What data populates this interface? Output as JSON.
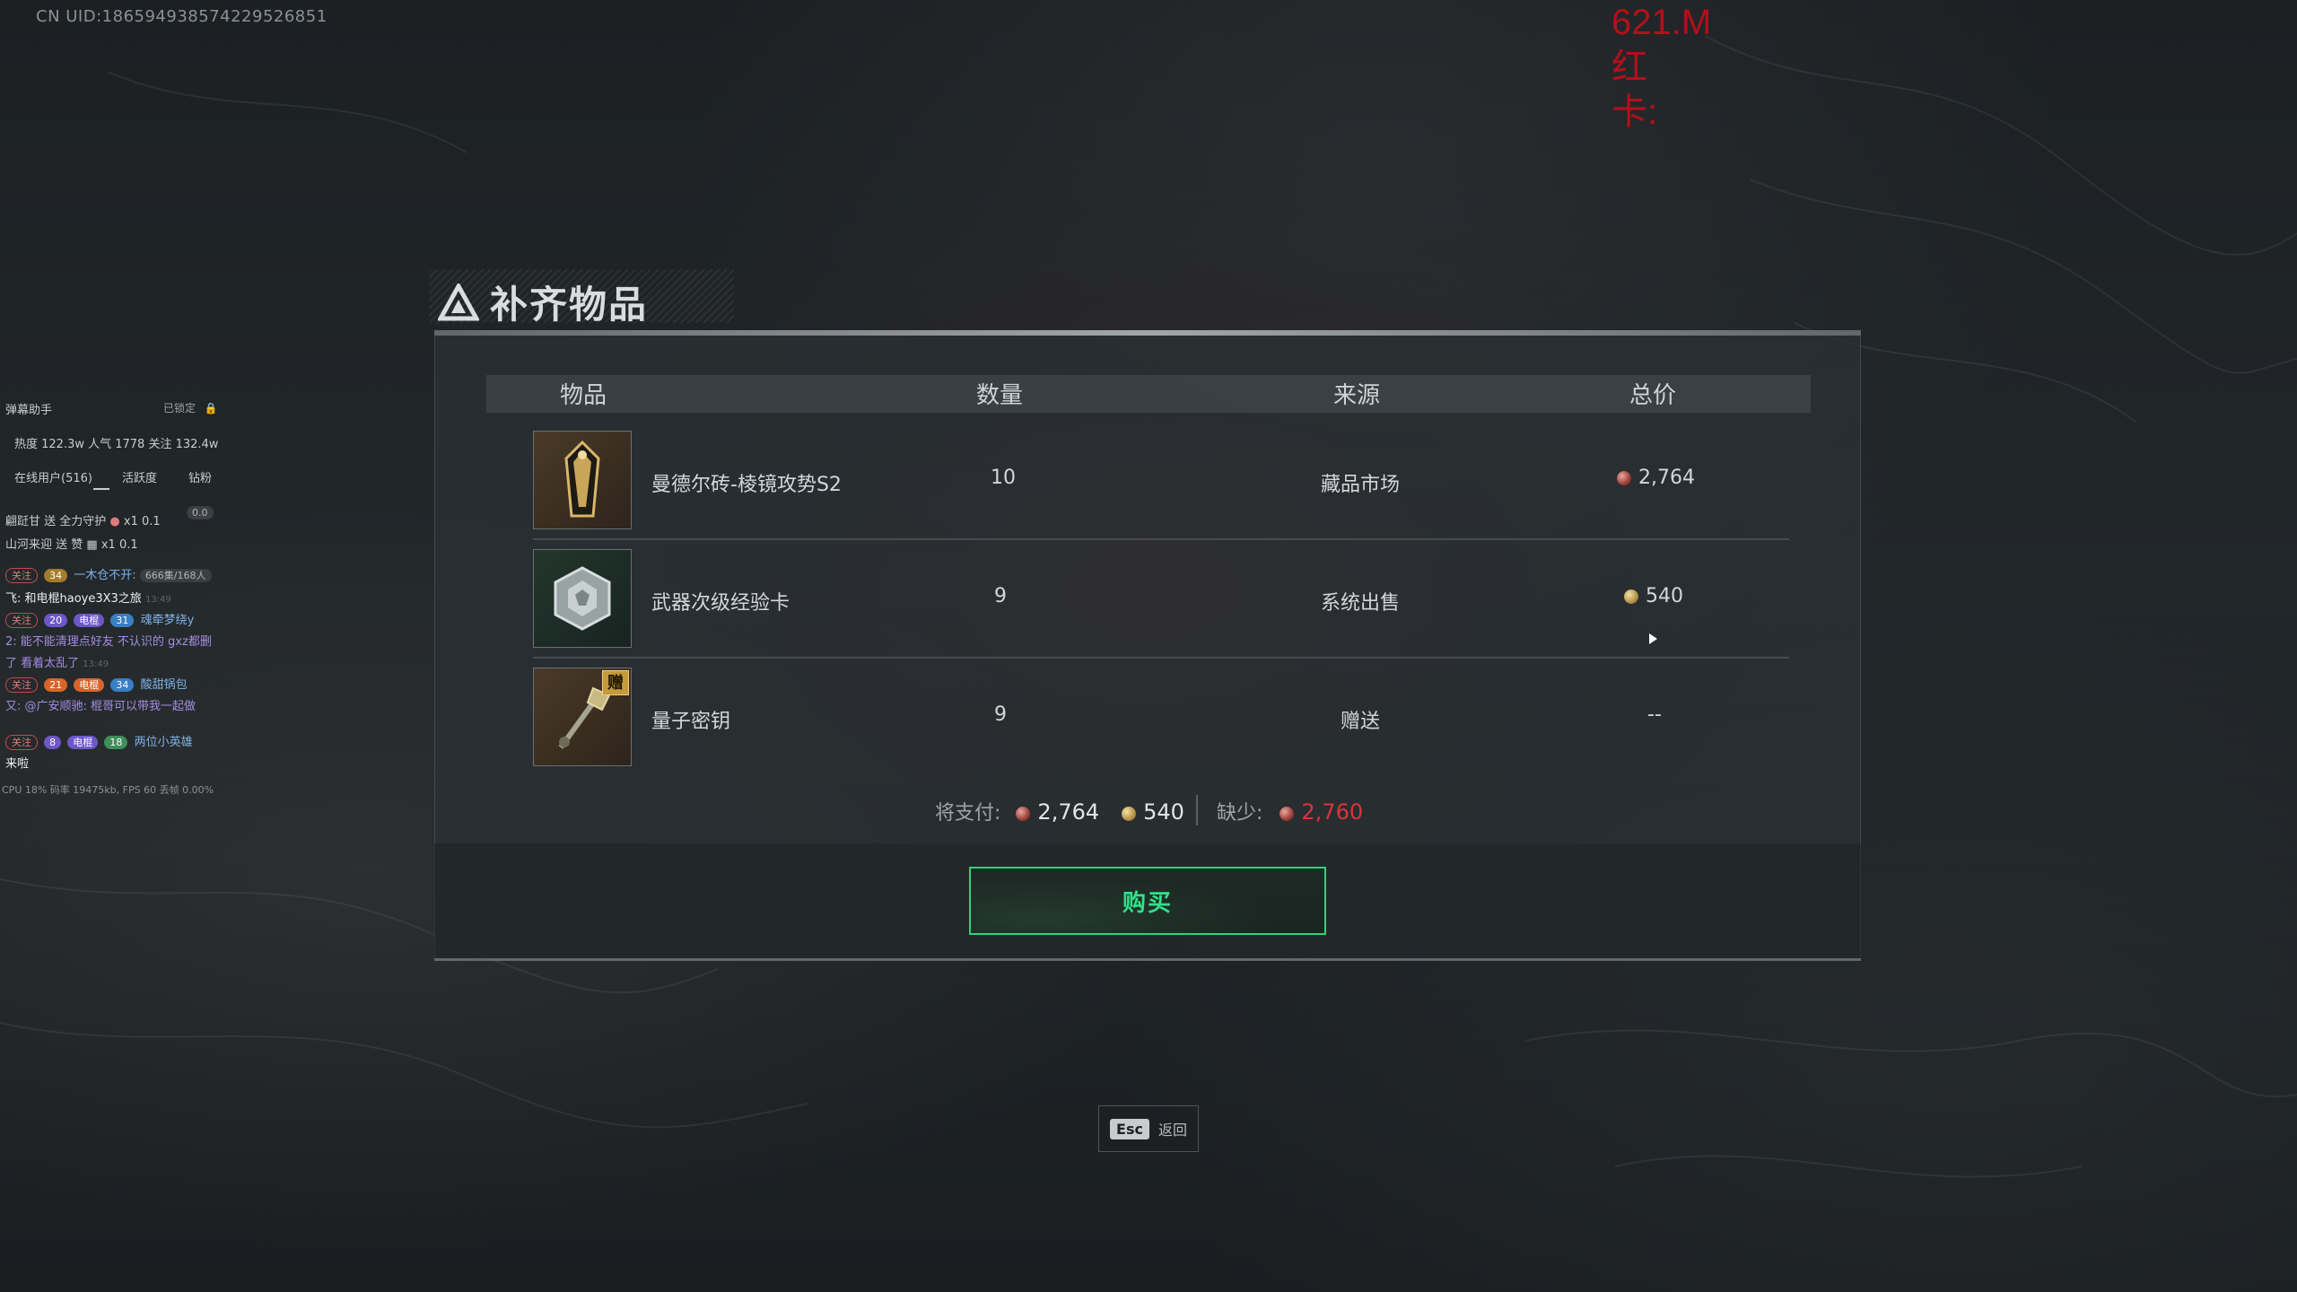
{
  "overlay": {
    "uid": "CN UID:18659493857422952685​1",
    "red_lines": [
      "621.M",
      "红",
      "卡:"
    ]
  },
  "stream_panel": {
    "title": "弹幕助手",
    "lock_label": "已锁定",
    "stats": "热度 122.3w 人气 1778 关注 132.4w",
    "tabs": [
      "在线用户(516)",
      "活跃度",
      "钻粉"
    ],
    "badge_zero": "0.0",
    "gift1_name": "翩跹甘 送 全力守护",
    "gift1_count": "x1",
    "gift1_extra": "0.1",
    "gift2_name": "山河来迎 送 赞",
    "gift2_count": "x1",
    "gift2_extra": "0.1",
    "chat1_tag1": "关注",
    "chat1_tag2": "34",
    "chat1_name": "一木仓不开:",
    "chat1_count": "666集/168人",
    "chat2_text": "飞: 和电棍haoye3X3之旅",
    "chat2_time": "13:49",
    "chat3_tag1": "关注",
    "chat3_tag2": "20",
    "chat3_tag3": "电棍",
    "chat3_tag4": "31",
    "chat3_name": "魂牵梦绕y",
    "chat4_text": "2: 能不能清理点好友 不认识的 gxz都删",
    "chat5_text": "了 看着太乱了",
    "chat5_time": "13:49",
    "chat6_tag1": "关注",
    "chat6_tag2": "21",
    "chat6_tag3": "电棍",
    "chat6_tag4": "34",
    "chat6_name": "酸甜锅包",
    "chat7_text": "又: @广安顺驰: 棍哥可以带我一起做",
    "chat8_tag1": "关注",
    "chat8_tag2": "8",
    "chat8_tag3": "电棍",
    "chat8_tag4": "18",
    "chat8_name": "两位小英雄",
    "chat9_text": "来啦",
    "perf": "CPU 18% 码率 19475kb, FPS 60 丢帧 0.00%"
  },
  "dialog": {
    "title": "补齐物品",
    "columns": [
      "物品",
      "数量",
      "来源",
      "总价"
    ],
    "items": [
      {
        "name": "曼德尔砖-棱镜攻势S2",
        "quantity": "10",
        "source": "藏品市场",
        "price": "2,764",
        "currency": "red",
        "icon": "mandel-brick-icon",
        "gift": ""
      },
      {
        "name": "武器次级经验卡",
        "quantity": "9",
        "source": "系统出售",
        "price": "540",
        "currency": "gold",
        "icon": "weapon-exp-card-icon",
        "gift": ""
      },
      {
        "name": "量子密钥",
        "quantity": "9",
        "source": "赠送",
        "price": "--",
        "currency": "",
        "icon": "quantum-key-icon",
        "gift": "赠"
      }
    ],
    "summary": {
      "pay_label": "将支付:",
      "pay_red": "2,764",
      "pay_gold": "540",
      "short_label": "缺少:",
      "short_red": "2,760"
    },
    "buy_label": "购买",
    "esc_key": "Esc",
    "esc_label": "返回"
  },
  "colors": {
    "accent_green": "#32e08a",
    "shortage_red": "#d6353d",
    "overlay_red": "#b3101a"
  }
}
